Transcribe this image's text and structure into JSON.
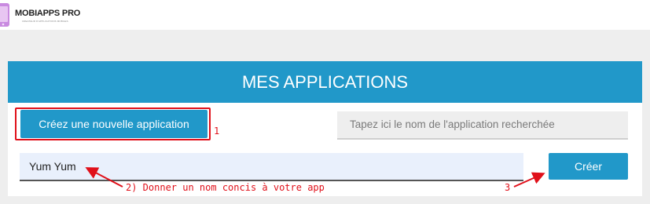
{
  "header": {
    "logo_icon": "phone-app-logo-icon",
    "brand": "MOBIAPPS PRO",
    "tagline": "CREATEUR D'APPLICATIONS MOBILES"
  },
  "page": {
    "title": "MES APPLICATIONS",
    "new_app_button": "Créez une nouvelle application",
    "search_placeholder": "Tapez ici le nom de l'application recherchée",
    "app_name_value": "Yum Yum",
    "create_button": "Créer"
  },
  "annotations": {
    "step1": "1",
    "step2": "2) Donner un nom concis à votre app",
    "step3": "3",
    "color": "#e0101a"
  },
  "colors": {
    "accent": "#2198c9",
    "background": "#eeeeee",
    "input_fill": "#e9f0fc"
  }
}
